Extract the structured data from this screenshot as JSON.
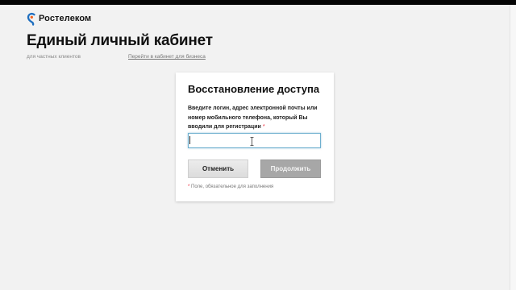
{
  "brand": {
    "name": "Ростелеком",
    "accent": "#1f6fbf"
  },
  "header": {
    "title": "Единый личный кабинет",
    "subtitle": "для частных клиентов",
    "business_link": "Перейти в кабинет для бизнеса"
  },
  "recovery": {
    "title": "Восстановление доступа",
    "instructions": "Введите логин, адрес электронной почты или номер мобильного телефона, который Вы вводили для регистрации",
    "required_mark": "*",
    "input_value": "",
    "cancel_label": "Отменить",
    "continue_label": "Продолжить",
    "required_note": "Поле, обязательное для заполнения"
  },
  "colors": {
    "background": "#f2f2f2",
    "continue_disabled": "#a7a7a7",
    "required_star": "#e23333"
  },
  "icons": [
    "rostelecom-logo-icon",
    "text-cursor-icon"
  ]
}
